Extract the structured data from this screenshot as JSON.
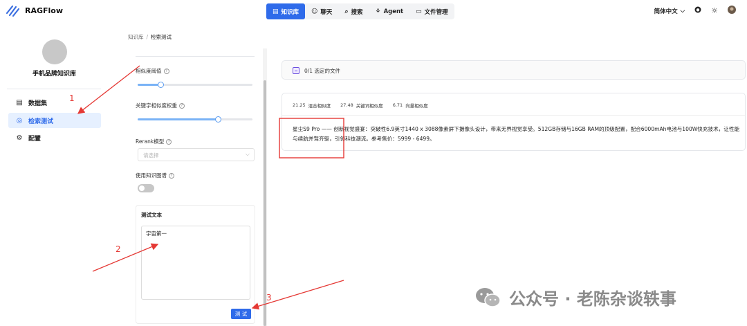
{
  "app": {
    "name": "RAGFlow",
    "brand_color": "#2f6bea"
  },
  "nav": {
    "tabs": [
      {
        "label": "知识库",
        "icon": "knowledge-base-icon",
        "active": true
      },
      {
        "label": "聊天",
        "icon": "chat-icon",
        "active": false
      },
      {
        "label": "搜索",
        "icon": "search-icon",
        "active": false
      },
      {
        "label": "Agent",
        "icon": "agent-icon",
        "active": false
      },
      {
        "label": "文件管理",
        "icon": "folder-icon",
        "active": false
      }
    ],
    "language": "简体中文",
    "icons": [
      "github-icon",
      "theme-toggle-icon",
      "user-avatar"
    ]
  },
  "sidebar": {
    "kb_name": "手机品牌知识库",
    "items": [
      {
        "label": "数据集",
        "icon": "dataset-icon",
        "active": false
      },
      {
        "label": "检索测试",
        "icon": "retrieval-test-icon",
        "active": true
      },
      {
        "label": "配置",
        "icon": "settings-icon",
        "active": false
      }
    ]
  },
  "breadcrumb": {
    "root": "知识库",
    "separator": "/",
    "current": "检索测试"
  },
  "settings": {
    "similarity_threshold": {
      "label": "相似度阈值",
      "value": 0.2
    },
    "keyword_weight": {
      "label": "关键字相似度权重",
      "value": 0.7
    },
    "rerank": {
      "label": "Rerank模型",
      "placeholder": "请选择"
    },
    "knowledge_graph": {
      "label": "使用知识图谱",
      "enabled": false
    },
    "test_text": {
      "title": "测试文本",
      "value": "宇宙第一",
      "button": "测 试"
    }
  },
  "results": {
    "selected_files": "0/1 选定的文件",
    "items": [
      {
        "hybrid_score": "21.25",
        "hybrid_label": "混合相似度",
        "keyword_score": "27.48",
        "keyword_label": "关键词相似度",
        "vector_score": "6.71",
        "vector_label": "向量相似度",
        "content": "星尘S9 Pro —— 创新视觉盛宴：突破性6.9英寸1440 x 3088像素屏下摄像头设计，带来无界视觉享受。512GB存储与16GB RAM的顶级配置，配合6000mAh电池与100W快充技术，让性能与续航并驾齐驱，引领科技潮流。参考售价：5999 - 6499。"
      }
    ]
  },
  "annotations": {
    "labels": [
      "1",
      "2",
      "3"
    ],
    "color": "#e53935"
  },
  "watermark": {
    "text": "公众号 · 老陈杂谈轶事"
  }
}
